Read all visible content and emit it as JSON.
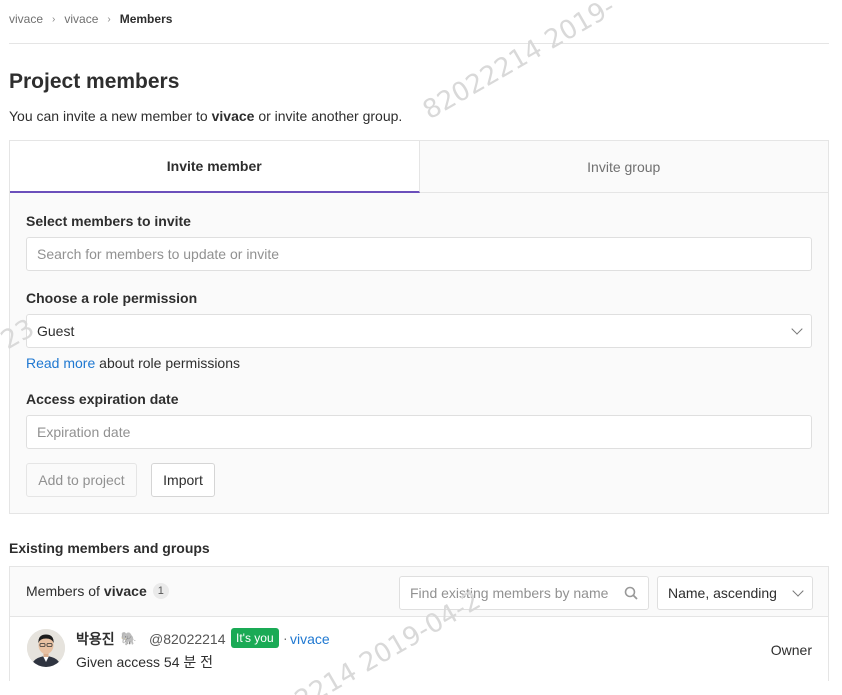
{
  "breadcrumb": {
    "items": [
      "vivace",
      "vivace"
    ],
    "current": "Members"
  },
  "page": {
    "title": "Project members",
    "intro_prefix": "You can invite a new member to ",
    "intro_project": "vivace",
    "intro_suffix": " or invite another group."
  },
  "invite": {
    "tabs": [
      {
        "label": "Invite member",
        "active": true
      },
      {
        "label": "Invite group",
        "active": false
      }
    ],
    "select_label": "Select members to invite",
    "search_placeholder": "Search for members to update or invite",
    "role_label": "Choose a role permission",
    "role_value": "Guest",
    "read_more_link": "Read more",
    "read_more_suffix": " about role permissions",
    "expiration_label": "Access expiration date",
    "expiration_placeholder": "Expiration date",
    "add_button": "Add to project",
    "import_button": "Import"
  },
  "existing": {
    "title": "Existing members and groups",
    "members_of_prefix": "Members of",
    "project": "vivace",
    "count": "1",
    "search_placeholder": "Find existing members by name",
    "sort_value": "Name, ascending",
    "members": [
      {
        "name": "박용진",
        "emoji": "🐘",
        "handle": "@82022214",
        "badge": "It's you",
        "separator": "·",
        "source": "vivace",
        "given": "Given access 54 분 전",
        "role": "Owner"
      }
    ]
  },
  "watermark": {
    "text_1": "82022214  2019-",
    "text_2": "2214  2019-04-2",
    "text_3": "23"
  },
  "colors": {
    "accent_tab": "#6b4fbb",
    "link": "#1f78d1",
    "badge_green": "#1aaa55"
  }
}
